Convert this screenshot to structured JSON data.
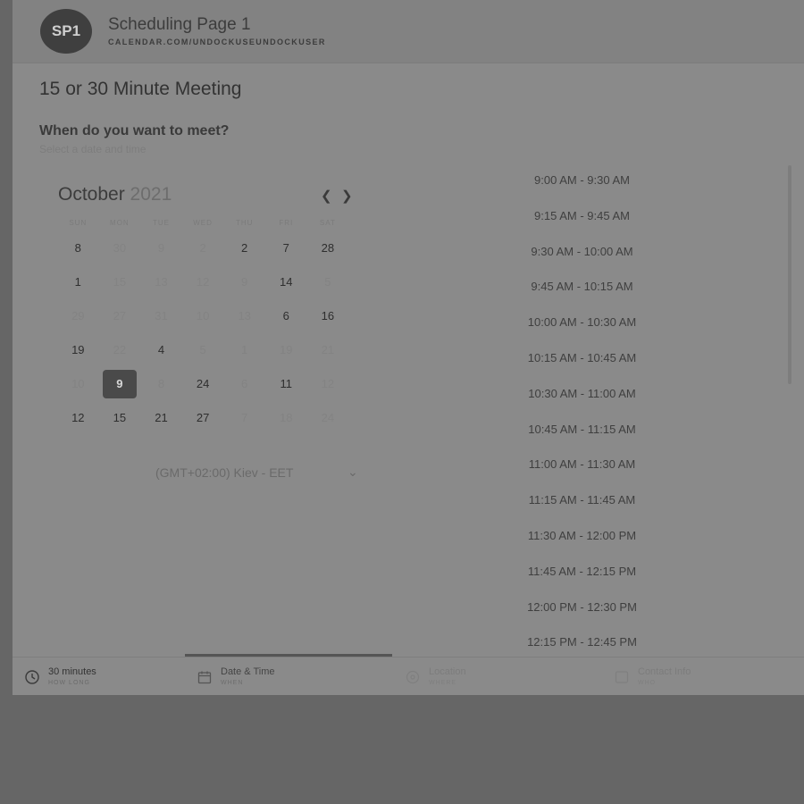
{
  "header": {
    "avatar_initials": "SP1",
    "page_name": "Scheduling Page 1",
    "page_url": "CALENDAR.COM/UNDOCKUSEUNDOCKUSER"
  },
  "meeting_title": "15 or 30 Minute Meeting",
  "question": "When do you want to meet?",
  "subtext": "Select a date and time",
  "calendar": {
    "month": "October",
    "year": "2021",
    "weekdays": [
      "SUN",
      "MON",
      "TUE",
      "WED",
      "THU",
      "FRI",
      "SAT"
    ],
    "rows": [
      [
        {
          "d": "8",
          "s": "on"
        },
        {
          "d": "30",
          "s": "off"
        },
        {
          "d": "9",
          "s": "off"
        },
        {
          "d": "2",
          "s": "off"
        },
        {
          "d": "2",
          "s": "on"
        },
        {
          "d": "7",
          "s": "on"
        },
        {
          "d": "28",
          "s": "on"
        }
      ],
      [
        {
          "d": "1",
          "s": "on"
        },
        {
          "d": "15",
          "s": "off"
        },
        {
          "d": "13",
          "s": "off"
        },
        {
          "d": "12",
          "s": "off"
        },
        {
          "d": "9",
          "s": "off"
        },
        {
          "d": "14",
          "s": "on"
        },
        {
          "d": "5",
          "s": "off"
        }
      ],
      [
        {
          "d": "29",
          "s": "off"
        },
        {
          "d": "27",
          "s": "off"
        },
        {
          "d": "31",
          "s": "off"
        },
        {
          "d": "10",
          "s": "off"
        },
        {
          "d": "13",
          "s": "off"
        },
        {
          "d": "6",
          "s": "on"
        },
        {
          "d": "16",
          "s": "on"
        }
      ],
      [
        {
          "d": "19",
          "s": "on"
        },
        {
          "d": "22",
          "s": "off"
        },
        {
          "d": "4",
          "s": "on"
        },
        {
          "d": "5",
          "s": "off"
        },
        {
          "d": "1",
          "s": "off"
        },
        {
          "d": "19",
          "s": "off"
        },
        {
          "d": "21",
          "s": "off"
        }
      ],
      [
        {
          "d": "10",
          "s": "off"
        },
        {
          "d": "9",
          "s": "sel"
        },
        {
          "d": "8",
          "s": "off"
        },
        {
          "d": "24",
          "s": "on"
        },
        {
          "d": "6",
          "s": "off"
        },
        {
          "d": "11",
          "s": "on"
        },
        {
          "d": "12",
          "s": "off"
        }
      ],
      [
        {
          "d": "12",
          "s": "on"
        },
        {
          "d": "15",
          "s": "on"
        },
        {
          "d": "21",
          "s": "on"
        },
        {
          "d": "27",
          "s": "on"
        },
        {
          "d": "7",
          "s": "off"
        },
        {
          "d": "18",
          "s": "off"
        },
        {
          "d": "24",
          "s": "off"
        }
      ]
    ]
  },
  "timezone": "(GMT+02:00) Kiev - EET",
  "time_slots": [
    "9:00 AM - 9:30 AM",
    "9:15 AM - 9:45 AM",
    "9:30 AM - 10:00 AM",
    "9:45 AM - 10:15 AM",
    "10:00 AM - 10:30 AM",
    "10:15 AM - 10:45 AM",
    "10:30 AM - 11:00 AM",
    "10:45 AM - 11:15 AM",
    "11:00 AM - 11:30 AM",
    "11:15 AM - 11:45 AM",
    "11:30 AM - 12:00 PM",
    "11:45 AM - 12:15 PM",
    "12:00 PM - 12:30 PM",
    "12:15 PM - 12:45 PM"
  ],
  "steps": [
    {
      "title": "30 minutes",
      "sub": "HOW LONG",
      "icon": "clock-icon",
      "state": "done"
    },
    {
      "title": "Date & Time",
      "sub": "WHEN",
      "icon": "calendar-icon",
      "state": "active"
    },
    {
      "title": "Location",
      "sub": "WHERE",
      "icon": "location-pin-icon",
      "state": "pending"
    },
    {
      "title": "Contact Info",
      "sub": "WHO",
      "icon": "contact-card-icon",
      "state": "pending"
    }
  ],
  "colors": {
    "backdrop": "#666666",
    "panel": "#8a8a8a",
    "selected_day": "#4a4a4a"
  }
}
